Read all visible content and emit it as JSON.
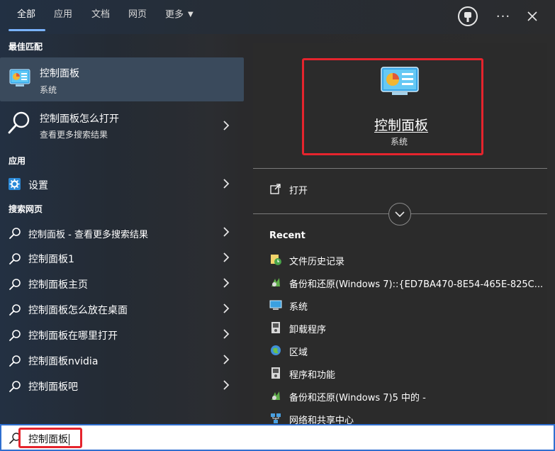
{
  "tabs": [
    {
      "label": "全部",
      "active": true
    },
    {
      "label": "应用"
    },
    {
      "label": "文档"
    },
    {
      "label": "网页"
    },
    {
      "label": "更多"
    }
  ],
  "left": {
    "best_match_header": "最佳匹配",
    "best_match": {
      "title": "控制面板",
      "subtitle": "系统",
      "icon": "control-panel-icon"
    },
    "search_suggestion": {
      "title": "控制面板怎么打开",
      "subtitle": "查看更多搜索结果"
    },
    "apps_header": "应用",
    "settings_label": "设置",
    "web_header": "搜索网页",
    "web_results": [
      "控制面板 - 查看更多搜索结果",
      "控制面板1",
      "控制面板主页",
      "控制面板怎么放在桌面",
      "控制面板在哪里打开",
      "控制面板nvidia",
      "控制面板吧"
    ]
  },
  "right": {
    "app_title": "控制面板",
    "app_subtitle": "系统",
    "open_label": "打开",
    "recent_header": "Recent",
    "recent": [
      {
        "label": "文件历史记录",
        "icon": "file-history-icon"
      },
      {
        "label": "备份和还原(Windows 7)::{ED7BA470-8E54-465E-825C...",
        "icon": "backup-icon"
      },
      {
        "label": "系统",
        "icon": "system-icon"
      },
      {
        "label": "卸载程序",
        "icon": "programs-icon"
      },
      {
        "label": "区域",
        "icon": "region-icon"
      },
      {
        "label": "程序和功能",
        "icon": "programs-icon"
      },
      {
        "label": "备份和还原(Windows 7)5 中的 -",
        "icon": "backup-icon"
      },
      {
        "label": "网络和共享中心",
        "icon": "network-icon"
      }
    ]
  },
  "search": {
    "value": "控制面板"
  },
  "colors": {
    "accent": "#7ab3ff",
    "highlight": "#e5242d",
    "search_border": "#2f6fd0"
  }
}
